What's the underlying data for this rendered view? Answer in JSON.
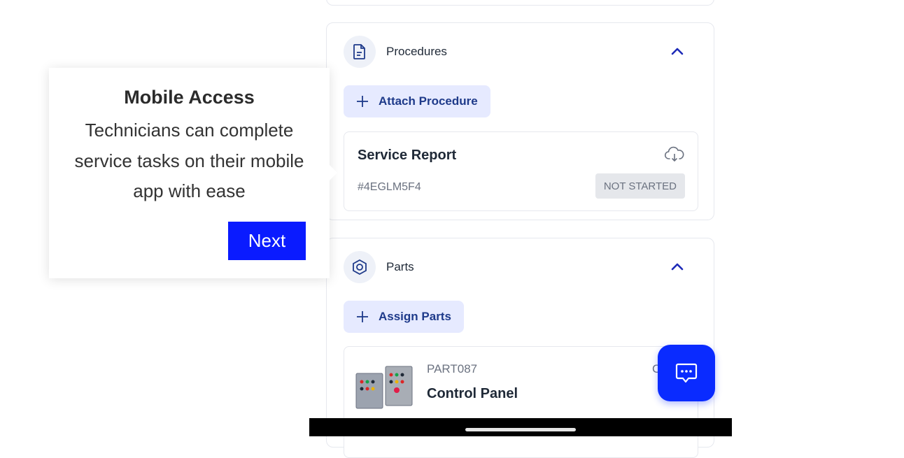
{
  "tooltip": {
    "title": "Mobile Access",
    "body": "Technicians can complete service tasks on their mobile app with ease",
    "next_label": "Next"
  },
  "procedures": {
    "title": "Procedures",
    "attach_label": "Attach Procedure",
    "item": {
      "title": "Service Report",
      "id": "#4EGLM5F4",
      "status": "NOT STARTED"
    }
  },
  "parts": {
    "title": "Parts",
    "assign_label": "Assign Parts",
    "item": {
      "code": "PART087",
      "name": "Control Panel",
      "partial": "C"
    }
  },
  "colors": {
    "accent": "#0a1bff",
    "pill_bg": "#e6eaff",
    "badge_bg": "#e5e7eb"
  },
  "icons": [
    "document-icon",
    "chevron-up-icon",
    "plus-icon",
    "cloud-download-icon",
    "hexagon-nut-icon",
    "chat-icon"
  ]
}
